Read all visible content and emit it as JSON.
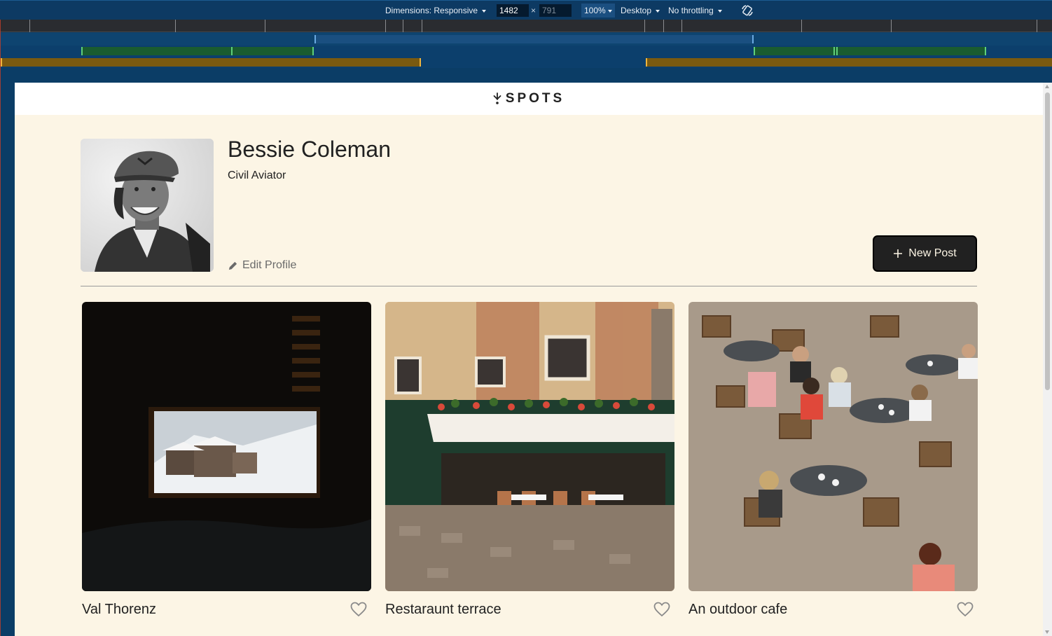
{
  "devtools": {
    "dimensions_label": "Dimensions: Responsive",
    "width_value": "1482",
    "times": "×",
    "height_value": "791",
    "zoom_label": "100%",
    "device_label": "Desktop",
    "throttling_label": "No throttling",
    "rotate_icon": "rotate-icon",
    "colors": {
      "toolbar": "#0d3a63",
      "mq_blue": "#1a4f80",
      "mq_green": "#1a5c30",
      "mq_orange": "#7a5a10"
    }
  },
  "site": {
    "logo_text": "SPOTS",
    "logo_icon": "spots-logo-icon"
  },
  "profile": {
    "name": "Bessie Coleman",
    "role": "Civil Aviator",
    "edit_label": "Edit Profile",
    "edit_icon": "pencil-icon",
    "new_post_label": "New Post",
    "new_post_icon": "plus-icon"
  },
  "cards": [
    {
      "title": "Val Thorenz",
      "liked": false,
      "like_icon": "heart-outline-icon"
    },
    {
      "title": "Restaraunt terrace",
      "liked": false,
      "like_icon": "heart-outline-icon"
    },
    {
      "title": "An outdoor cafe",
      "liked": false,
      "like_icon": "heart-outline-icon"
    }
  ],
  "colors": {
    "page_background": "#fcf5e5",
    "header_background": "#ffffff",
    "text": "#212121",
    "muted_text": "#6a6a6a",
    "button_background": "#212121"
  }
}
